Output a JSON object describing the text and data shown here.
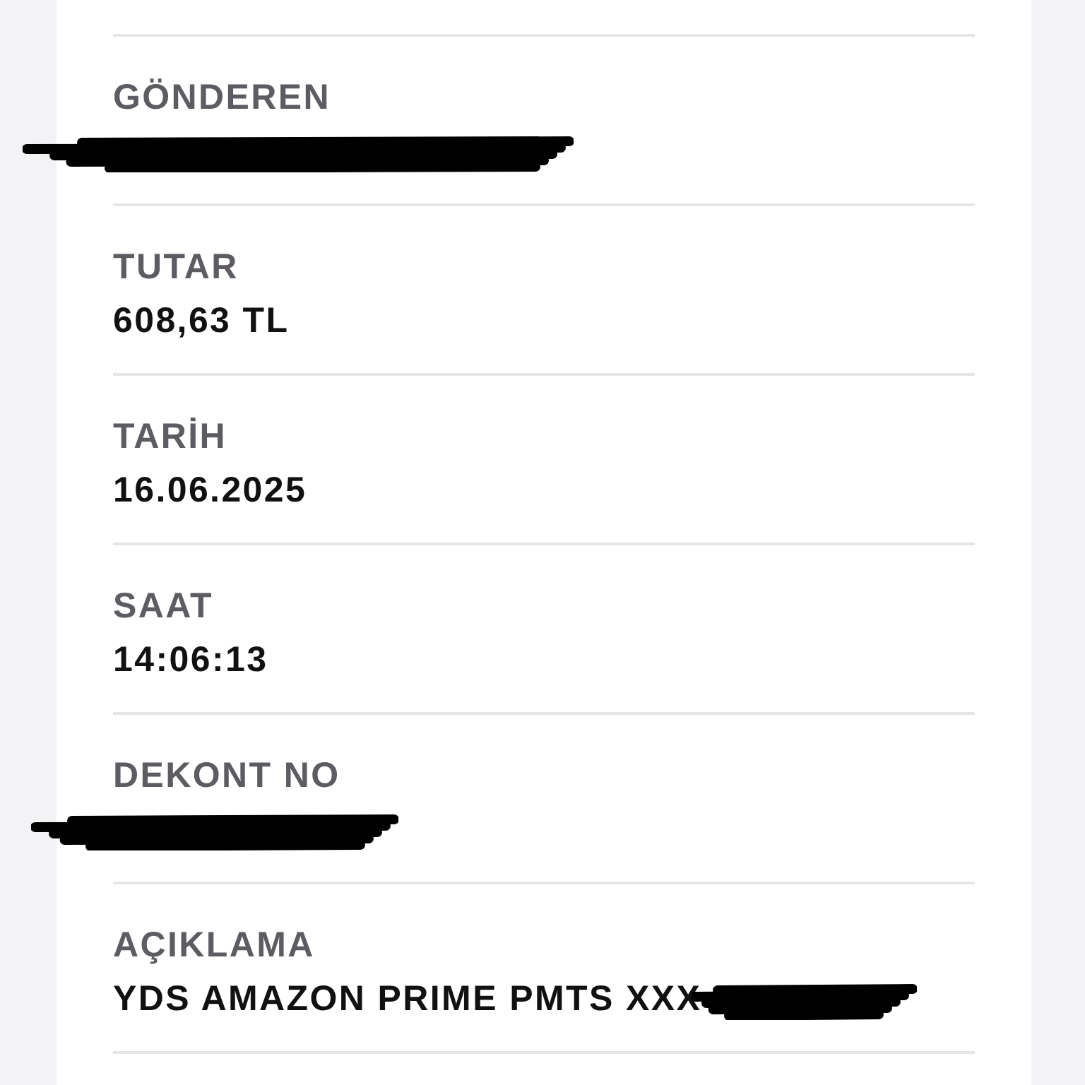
{
  "fields": [
    {
      "label": "GÖNDEREN",
      "redacted": true
    },
    {
      "label": "TUTAR",
      "value": "608,63 TL",
      "redacted": false
    },
    {
      "label": "TARİH",
      "value": "16.06.2025",
      "redacted": false
    },
    {
      "label": "SAAT",
      "value": "14:06:13",
      "redacted": false
    },
    {
      "label": "DEKONT NO",
      "redacted": true
    },
    {
      "label": "AÇIKLAMA",
      "value": "YDS AMAZON PRIME PMTS XXX",
      "redacted": true
    }
  ]
}
